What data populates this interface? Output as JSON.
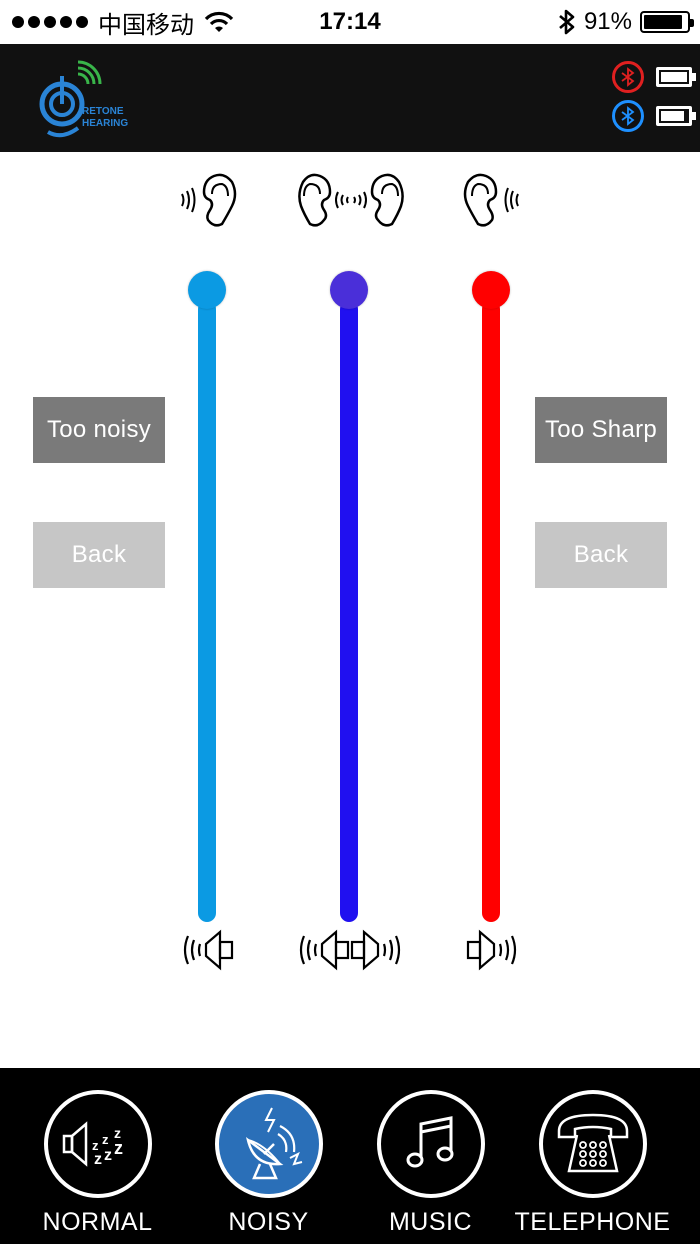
{
  "status_bar": {
    "carrier": "中国移动",
    "time": "17:14",
    "battery_percent": "91%",
    "battery_level": 0.91,
    "icons": [
      "signal-dots-icon",
      "wifi-icon",
      "bluetooth-icon",
      "battery-icon"
    ]
  },
  "header": {
    "logo_text_line1": "RETONE",
    "logo_text_line2": "HEARING",
    "devices": [
      {
        "side": "right",
        "color": "#e02020",
        "icon": "bluetooth-icon",
        "battery_level": 1.0
      },
      {
        "side": "left",
        "color": "#1e90ff",
        "icon": "bluetooth-icon",
        "battery_level": 0.9
      }
    ]
  },
  "sliders": [
    {
      "name": "left",
      "color": "#0b9ae3",
      "knob_color": "#0b9ae3",
      "level": 1.0,
      "top_icon": "ear-left-icon",
      "bottom_icon": "speaker-left-icon"
    },
    {
      "name": "both",
      "color": "#2010f0",
      "knob_color": "#4a2fd9",
      "level": 1.0,
      "top_icon": "ear-both-icon",
      "bottom_icon": "speaker-both-icon"
    },
    {
      "name": "right",
      "color": "#ff0000",
      "knob_color": "#ff0000",
      "level": 1.0,
      "top_icon": "ear-right-icon",
      "bottom_icon": "speaker-right-icon"
    }
  ],
  "buttons": {
    "too_noisy": "Too noisy",
    "back_left": "Back",
    "too_sharp": "Too Sharp",
    "back_right": "Back"
  },
  "tabs": [
    {
      "label": "NORMAL",
      "icon": "speaker-zzz-icon",
      "active": false
    },
    {
      "label": "NOISY",
      "icon": "satellite-dish-icon",
      "active": true
    },
    {
      "label": "MUSIC",
      "icon": "music-note-icon",
      "active": false
    },
    {
      "label": "TELEPHONE",
      "icon": "telephone-icon",
      "active": false
    }
  ],
  "colors": {
    "accent_blue": "#0b9ae3",
    "accent_violet": "#2010f0",
    "accent_red": "#ff0000",
    "tab_active": "#2a6fb8"
  }
}
